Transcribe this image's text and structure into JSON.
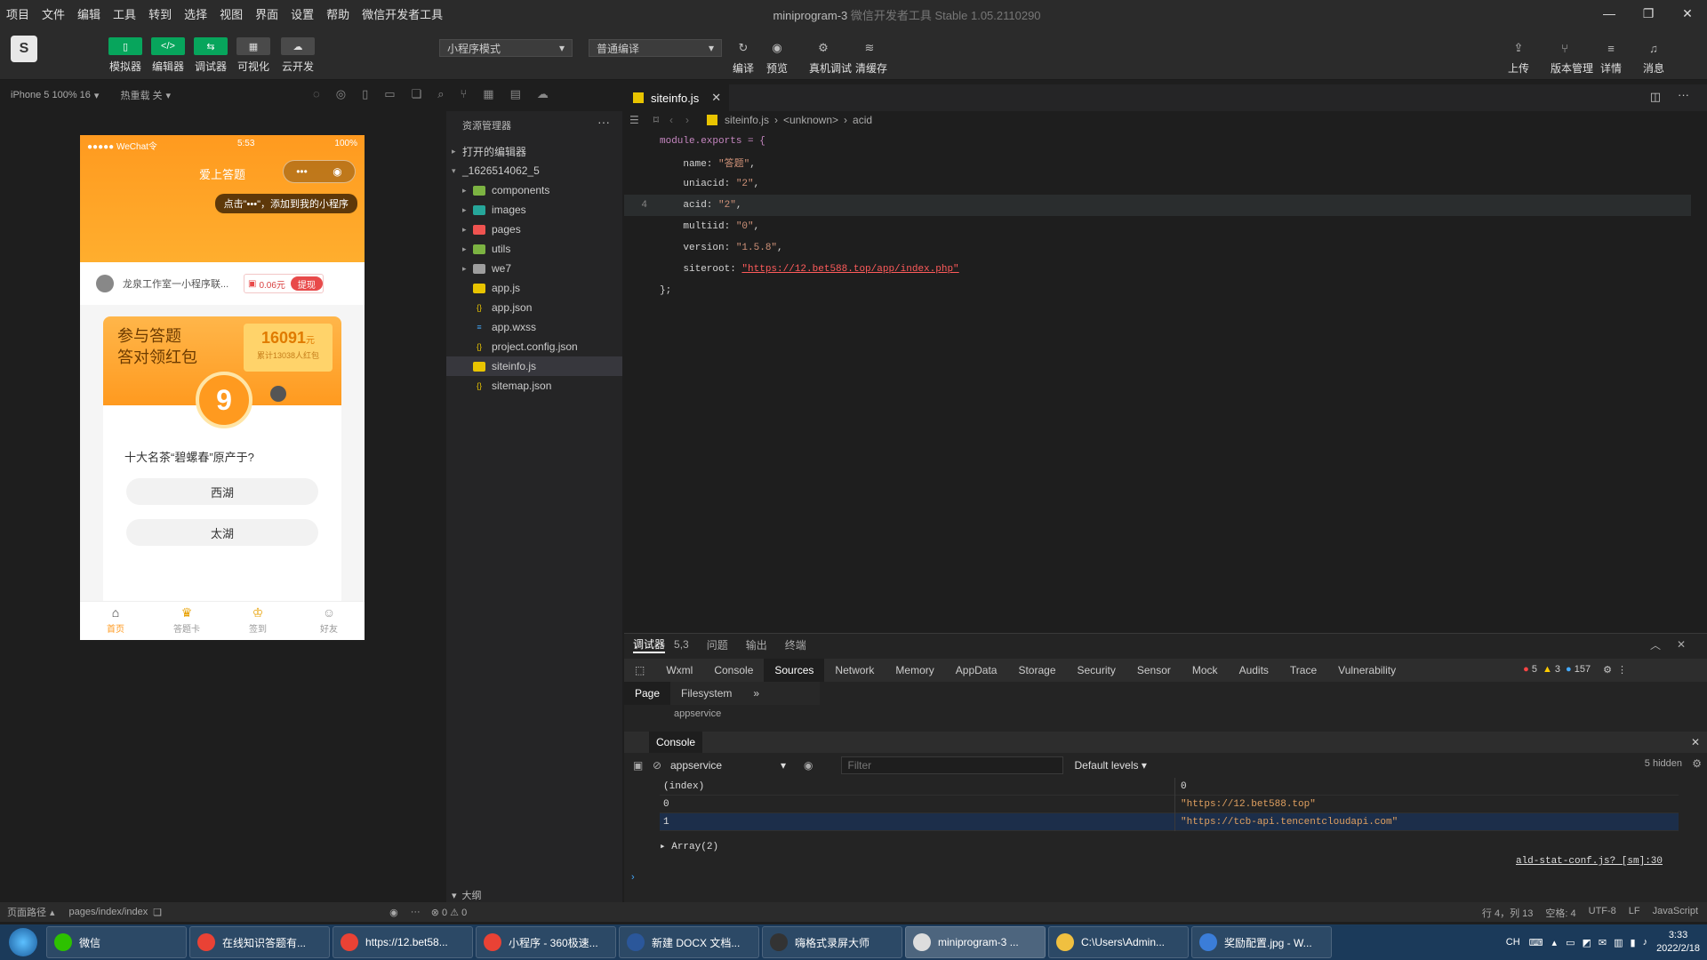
{
  "menu": [
    "项目",
    "文件",
    "编辑",
    "工具",
    "转到",
    "选择",
    "视图",
    "界面",
    "设置",
    "帮助",
    "微信开发者工具"
  ],
  "window_title": "miniprogram-3",
  "window_title_suffix": "微信开发者工具 Stable 1.05.2110290",
  "toolbar": {
    "simulator": "模拟器",
    "editor": "编辑器",
    "debugger": "调试器",
    "visualize": "可视化",
    "cloud": "云开发",
    "mode": "小程序模式",
    "compile_mode": "普通编译",
    "compile": "编译",
    "preview": "预览",
    "remote_debug": "真机调试",
    "clear_cache": "清缓存",
    "upload": "上传",
    "version": "版本管理",
    "details": "详情",
    "messages": "消息"
  },
  "sim_header": {
    "device": "iPhone 5 100% 16",
    "hot_reload": "热重载 关"
  },
  "phone": {
    "carrier": "●●●●● WeChat令",
    "time": "5:53",
    "battery": "100%",
    "nav_title": "爱上答题",
    "capsule_more": "•••",
    "tip": "点击\"•••\"，添加到我的小程序",
    "user_name": "龙泉工作室一小程序联...",
    "balance": "0.06元",
    "withdraw": "提现",
    "card_title_1": "参与答题",
    "card_title_2": "答对领红包",
    "score": "16091",
    "score_unit": "元",
    "score_sub": "累计13038人红包",
    "timer": "9",
    "question": "十大名茶“碧螺春”原产于?",
    "answers": [
      "西湖",
      "太湖"
    ],
    "tabs": [
      "首页",
      "答题卡",
      "签到",
      "好友"
    ]
  },
  "explorer": {
    "title": "资源管理器",
    "open_editors": "打开的编辑器",
    "project": "_1626514062_5",
    "items": [
      {
        "name": "components",
        "type": "folder",
        "color": "#7cb342"
      },
      {
        "name": "images",
        "type": "folder",
        "color": "#26a69a"
      },
      {
        "name": "pages",
        "type": "folder",
        "color": "#ef5350"
      },
      {
        "name": "utils",
        "type": "folder",
        "color": "#7cb342"
      },
      {
        "name": "we7",
        "type": "folder",
        "color": "#9e9e9e"
      },
      {
        "name": "app.js",
        "type": "js",
        "color": "#e8c400"
      },
      {
        "name": "app.json",
        "type": "json",
        "color": "#e8c400"
      },
      {
        "name": "app.wxss",
        "type": "wxss",
        "color": "#42a5f5"
      },
      {
        "name": "project.config.json",
        "type": "json",
        "color": "#e8c400"
      },
      {
        "name": "siteinfo.js",
        "type": "js",
        "color": "#e8c400"
      },
      {
        "name": "sitemap.json",
        "type": "json",
        "color": "#e8c400"
      }
    ],
    "outline": "大纲"
  },
  "editor": {
    "tab": "siteinfo.js",
    "breadcrumb": [
      "siteinfo.js",
      "<unknown>",
      "acid"
    ],
    "current_line": "4",
    "lines": [
      {
        "n": "",
        "key": "module.exports = {",
        "val": "",
        "end": ""
      },
      {
        "n": "",
        "key": "    name: ",
        "val": "\"答题\"",
        "end": ","
      },
      {
        "n": "",
        "key": "    uniacid: ",
        "val": "\"2\"",
        "end": ","
      },
      {
        "n": "4",
        "key": "    acid: ",
        "val": "\"2\"",
        "end": ","
      },
      {
        "n": "",
        "key": "    multiid: ",
        "val": "\"0\"",
        "end": ","
      },
      {
        "n": "",
        "key": "    version: ",
        "val": "\"1.5.8\"",
        "end": ","
      },
      {
        "n": "",
        "key": "    siteroot: ",
        "val": "\"https://12.bet588.top/app/index.php\"",
        "end": ""
      },
      {
        "n": "",
        "key": "};",
        "val": "",
        "end": ""
      }
    ]
  },
  "debugger": {
    "top_tabs": [
      "调试器",
      "5,3",
      "问题",
      "输出",
      "终端"
    ],
    "panels": [
      "Wxml",
      "Console",
      "Sources",
      "Network",
      "Memory",
      "AppData",
      "Storage",
      "Security",
      "Sensor",
      "Mock",
      "Audits",
      "Trace",
      "Vulnerability"
    ],
    "active_panel": "Sources",
    "errors": "5",
    "warnings": "3",
    "infos": "157",
    "sub_tabs": [
      "Page",
      "Filesystem"
    ],
    "tree_fragment": "appservice",
    "console_tab": "Console",
    "context": "appservice",
    "filter_placeholder": "Filter",
    "levels": "Default levels",
    "hidden": "5 hidden",
    "table_header": [
      "(index)",
      "0"
    ],
    "rows": [
      {
        "index": "0",
        "value": "\"https://12.bet588.top\""
      },
      {
        "index": "1",
        "value": "\"https://tcb-api.tencentcloudapi.com\""
      }
    ],
    "array_label": "Array(2)",
    "source_link": "ald-stat-conf.js? [sm]:30"
  },
  "status": {
    "page_path_label": "页面路径",
    "page_path": "pages/index/index",
    "problems": "⊗ 0 ⚠ 0",
    "cursor": "行 4，列 13",
    "spaces": "空格: 4",
    "encoding": "UTF-8",
    "eol": "LF",
    "language": "JavaScript"
  },
  "taskbar": {
    "tasks": [
      {
        "label": "微信",
        "color": "#2dc100"
      },
      {
        "label": "在线知识答题有...",
        "color": "#e94235"
      },
      {
        "label": "https://12.bet58...",
        "color": "#e94235"
      },
      {
        "label": "小程序 - 360极速...",
        "color": "#e94235"
      },
      {
        "label": "新建 DOCX 文档...",
        "color": "#2b579a"
      },
      {
        "label": "嗨格式录屏大师",
        "color": "#333333"
      },
      {
        "label": "miniprogram-3 ...",
        "color": "#dddddd"
      },
      {
        "label": "C:\\Users\\Admin...",
        "color": "#f0c040"
      },
      {
        "label": "奖励配置.jpg - W...",
        "color": "#3b7dd8"
      }
    ],
    "ime": "CH",
    "time": "3:33",
    "date": "2022/2/18"
  }
}
